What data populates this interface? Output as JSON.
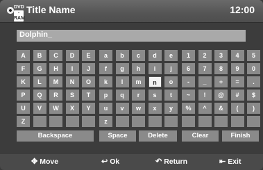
{
  "header": {
    "disc_line1": "DVD",
    "disc_line2": "-RAM",
    "title": "Title Name",
    "clock": "12:00"
  },
  "input": {
    "value": "Dolphin_"
  },
  "keyboard": {
    "rows": [
      [
        "A",
        "B",
        "C",
        "D",
        "E",
        "a",
        "b",
        "c",
        "d",
        "e",
        "1",
        "2",
        "3",
        "4",
        "5"
      ],
      [
        "F",
        "G",
        "H",
        "I",
        "J",
        "f",
        "g",
        "h",
        "i",
        "j",
        "6",
        "7",
        "8",
        "9",
        "0"
      ],
      [
        "K",
        "L",
        "M",
        "N",
        "O",
        "k",
        "l",
        "m",
        "n",
        "o",
        "-",
        "_",
        "+",
        "=",
        "."
      ],
      [
        "P",
        "Q",
        "R",
        "S",
        "T",
        "p",
        "q",
        "r",
        "s",
        "t",
        "~",
        "!",
        "@",
        "#",
        "$"
      ],
      [
        "U",
        "V",
        "W",
        "X",
        "Y",
        "u",
        "v",
        "w",
        "x",
        "y",
        "%",
        "^",
        "&",
        "(",
        ")"
      ],
      [
        "Z",
        "",
        "",
        "",
        "",
        "z",
        "",
        "",
        "",
        "",
        "",
        "",
        "",
        "",
        ""
      ]
    ],
    "selected": "n",
    "functions": {
      "backspace": "Backspace",
      "space": "Space",
      "delete": "Delete",
      "clear": "Clear",
      "finish": "Finish"
    }
  },
  "footer": {
    "move": "Move",
    "ok": "Ok",
    "return": "Return",
    "exit": "Exit"
  },
  "icons": {
    "disc": "dvd-ram-icon",
    "move": "four-way-arrow-icon",
    "ok": "enter-icon",
    "return": "return-arrow-icon",
    "exit": "exit-door-icon"
  },
  "colors": {
    "key": "#8a8a8a",
    "selected_key": "#f2f2f2",
    "input": "#a9a9a9"
  }
}
